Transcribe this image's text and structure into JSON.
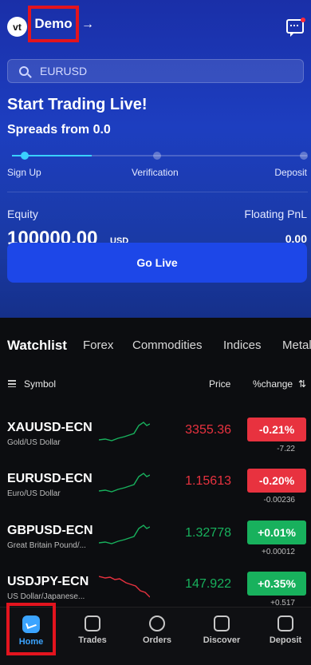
{
  "header": {
    "logo_text": "vt",
    "account_type": "Demo",
    "switch_arrow": "→"
  },
  "search": {
    "placeholder": "EURUSD"
  },
  "promo": {
    "title": "Start Trading Live!",
    "subtitle": "Spreads from 0.0",
    "steps": [
      "Sign Up",
      "Verification",
      "Deposit"
    ],
    "current_step": 1
  },
  "account": {
    "equity_label": "Equity",
    "equity_value": "100000.00",
    "currency": "USD",
    "pnl_label": "Floating PnL",
    "pnl_value": "0.00",
    "go_live_label": "Go Live"
  },
  "watchlist": {
    "tabs": [
      "Watchlist",
      "Forex",
      "Commodities",
      "Indices",
      "Metal"
    ],
    "active_tab": 0,
    "columns": {
      "symbol": "Symbol",
      "price": "Price",
      "change": "%change"
    },
    "rows": [
      {
        "symbol": "XAUUSD-ECN",
        "description": "Gold/US Dollar",
        "price": "3355.36",
        "change_pct": "-0.21%",
        "change_abs": "-7.22",
        "direction": "down",
        "trend": "up"
      },
      {
        "symbol": "EURUSD-ECN",
        "description": "Euro/US Dollar",
        "price": "1.15613",
        "change_pct": "-0.20%",
        "change_abs": "-0.00236",
        "direction": "down",
        "trend": "up"
      },
      {
        "symbol": "GBPUSD-ECN",
        "description": "Great Britain Pound/...",
        "price": "1.32778",
        "change_pct": "+0.01%",
        "change_abs": "+0.00012",
        "direction": "up",
        "trend": "up"
      },
      {
        "symbol": "USDJPY-ECN",
        "description": "US Dollar/Japanese...",
        "price": "147.922",
        "change_pct": "+0.35%",
        "change_abs": "+0.517",
        "direction": "up",
        "trend": "down"
      }
    ]
  },
  "bottom_nav": {
    "items": [
      {
        "label": "Home",
        "icon": "home-chart-icon"
      },
      {
        "label": "Trades",
        "icon": "trades-icon"
      },
      {
        "label": "Orders",
        "icon": "orders-icon"
      },
      {
        "label": "Discover",
        "icon": "discover-icon"
      },
      {
        "label": "Deposit",
        "icon": "deposit-icon"
      }
    ],
    "active_index": 0
  },
  "colors": {
    "accent": "#1d47e8",
    "up": "#18b15d",
    "down": "#e8323f",
    "hero_top": "#1a2fa8"
  }
}
